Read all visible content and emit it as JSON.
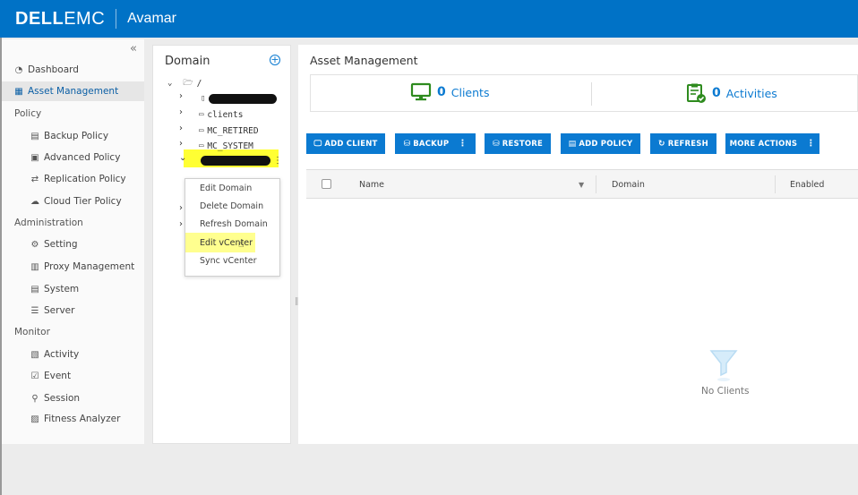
{
  "header": {
    "brand_bold": "DELL",
    "brand_light": "EMC",
    "product": "Avamar"
  },
  "sidebar": {
    "collapse_icon": "«",
    "items": [
      {
        "label": "Dashboard",
        "icon": "dashboard-icon"
      },
      {
        "label": "Asset Management",
        "icon": "asset-management-icon",
        "active": true
      },
      {
        "label": "Backup Policy",
        "icon": "backup-policy-icon"
      },
      {
        "label": "Advanced Policy",
        "icon": "advanced-policy-icon"
      },
      {
        "label": "Replication Policy",
        "icon": "replication-policy-icon"
      },
      {
        "label": "Cloud Tier Policy",
        "icon": "cloud-tier-icon"
      },
      {
        "label": "Setting",
        "icon": "setting-icon"
      },
      {
        "label": "Proxy Management",
        "icon": "proxy-icon"
      },
      {
        "label": "System",
        "icon": "system-icon"
      },
      {
        "label": "Server",
        "icon": "server-icon"
      },
      {
        "label": "Activity",
        "icon": "activity-icon"
      },
      {
        "label": "Event",
        "icon": "event-icon"
      },
      {
        "label": "Session",
        "icon": "session-icon"
      },
      {
        "label": "Fitness Analyzer",
        "icon": "fitness-icon"
      }
    ],
    "groups": {
      "policy": "Policy",
      "administration": "Administration",
      "monitor": "Monitor"
    }
  },
  "domain_panel": {
    "title": "Domain",
    "root": "/",
    "nodes": [
      "clients",
      "MC_RETIRED",
      "MC_SYSTEM"
    ]
  },
  "context_menu": {
    "items": [
      "Edit Domain",
      "Delete Domain",
      "Refresh Domain",
      "Edit vCenter",
      "Sync vCenter"
    ]
  },
  "main": {
    "title": "Asset Management",
    "clients_count": "0",
    "clients_label": "Clients",
    "activities_count": "0",
    "activities_label": "Activities",
    "buttons": {
      "add_client": "ADD CLIENT",
      "backup": "BACKUP",
      "restore": "RESTORE",
      "add_policy": "ADD POLICY",
      "refresh": "REFRESH",
      "more_actions": "MORE ACTIONS"
    },
    "columns": {
      "name": "Name",
      "domain": "Domain",
      "enabled": "Enabled"
    },
    "empty_text": "No Clients"
  },
  "colors": {
    "accent": "#0b7ad1",
    "header": "#0072c6",
    "highlight": "#ffff33",
    "stat_icon": "#2e8b1e"
  }
}
